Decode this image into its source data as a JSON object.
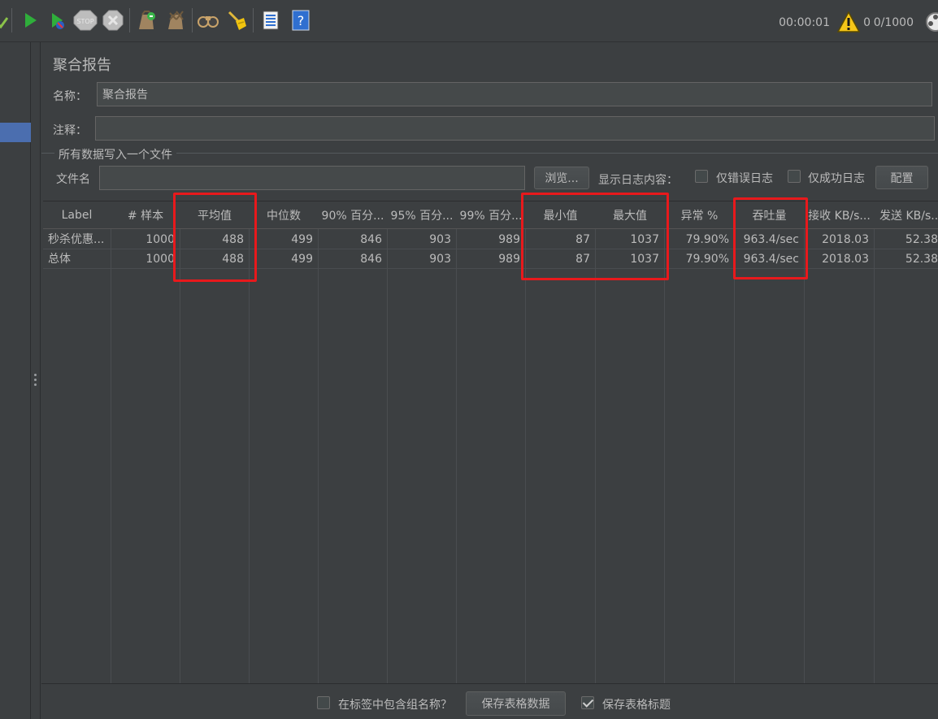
{
  "toolbar": {
    "icons": [
      "checkmark-icon",
      "start-icon",
      "start-no-pause-icon",
      "stop-icon",
      "shutdown-icon",
      "clear-icon",
      "clear-all-icon",
      "search-icon",
      "reset-search-icon",
      "function-helper-icon",
      "help-icon"
    ],
    "elapsed": "00:00:01",
    "warning_count": "0",
    "threads": "0/1000"
  },
  "panel": {
    "title": "聚合报告",
    "name_label": "名称：",
    "name_value": "聚合报告",
    "comment_label": "注释：",
    "comment_value": "",
    "group_title": "所有数据写入一个文件",
    "file_label": "文件名",
    "file_value": "",
    "browse_button": "浏览...",
    "log_label": "显示日志内容：",
    "errors_only": "仅错误日志",
    "success_only": "仅成功日志",
    "config_button": "配置"
  },
  "table": {
    "headers": [
      "Label",
      "# 样本",
      "平均值",
      "中位数",
      "90% 百分...",
      "95% 百分...",
      "99% 百分...",
      "最小值",
      "最大值",
      "异常 %",
      "吞吐量",
      "接收 KB/s...",
      "发送 KB/s..."
    ],
    "rows": [
      [
        "秒杀优惠...",
        "1000",
        "488",
        "499",
        "846",
        "903",
        "989",
        "87",
        "1037",
        "79.90%",
        "963.4/sec",
        "2018.03",
        "52.38"
      ],
      [
        "总体",
        "1000",
        "488",
        "499",
        "846",
        "903",
        "989",
        "87",
        "1037",
        "79.90%",
        "963.4/sec",
        "2018.03",
        "52.38"
      ]
    ]
  },
  "bottom": {
    "include_group_label": "在标签中包含组名称？",
    "save_table_button": "保存表格数据",
    "save_header_label": "保存表格标题"
  },
  "colors": {
    "background": "#3c3f41",
    "highlight": "#e8191c",
    "selection": "#4b6eaf"
  }
}
